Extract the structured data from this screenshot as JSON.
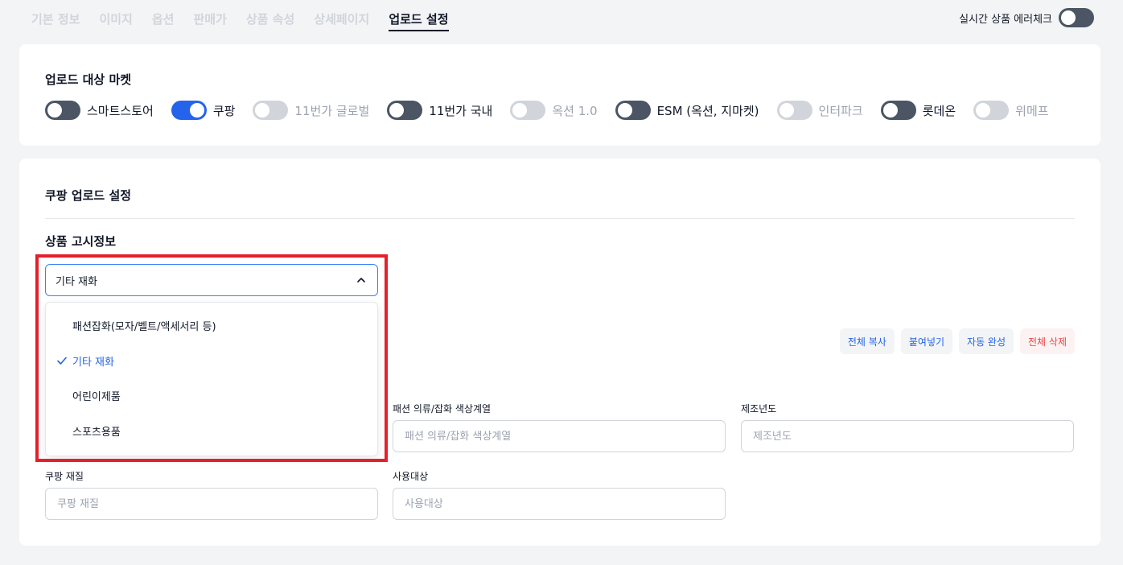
{
  "tabs": [
    {
      "label": "기본 정보"
    },
    {
      "label": "이미지"
    },
    {
      "label": "옵션"
    },
    {
      "label": "판매가"
    },
    {
      "label": "상품 속성"
    },
    {
      "label": "상세페이지"
    },
    {
      "label": "업로드 설정"
    }
  ],
  "error_check": {
    "label": "실시간 상품 에러체크",
    "enabled": false
  },
  "markets_card": {
    "title": "업로드 대상 마켓",
    "markets": [
      {
        "name": "스마트스토어",
        "state": "off"
      },
      {
        "name": "쿠팡",
        "state": "on"
      },
      {
        "name": "11번가 글로벌",
        "state": "disabled"
      },
      {
        "name": "11번가 국내",
        "state": "off"
      },
      {
        "name": "옥션 1.0",
        "state": "disabled"
      },
      {
        "name": "ESM (옥션, 지마켓)",
        "state": "off"
      },
      {
        "name": "인터파크",
        "state": "disabled"
      },
      {
        "name": "롯데온",
        "state": "off"
      },
      {
        "name": "위메프",
        "state": "disabled"
      }
    ]
  },
  "settings_card": {
    "title": "쿠팡 업로드 설정",
    "notice_section_title": "상품 고시정보",
    "select": {
      "value": "기타 재화",
      "options": [
        {
          "label": "패션잡화(모자/벨트/액세서리 등)",
          "selected": false
        },
        {
          "label": "기타 재화",
          "selected": true
        },
        {
          "label": "어린이제품",
          "selected": false
        },
        {
          "label": "스포츠용품",
          "selected": false
        }
      ]
    },
    "buttons": {
      "copy_all": "전체 복사",
      "paste": "붙여넣기",
      "autocomplete": "자동 완성",
      "delete_all": "전체 삭제"
    },
    "fields": {
      "color": {
        "label": "패션 의류/잡화 색상계열",
        "placeholder": "패션 의류/잡화 색상계열",
        "value": ""
      },
      "year": {
        "label": "제조년도",
        "placeholder": "제조년도",
        "value": ""
      },
      "material": {
        "label": "쿠팡 재질",
        "placeholder": "쿠팡 재질",
        "value": ""
      },
      "target": {
        "label": "사용대상",
        "placeholder": "사용대상",
        "value": ""
      }
    }
  },
  "colors": {
    "accent": "#2563eb",
    "highlight": "#e3202b",
    "danger": "#ef4444"
  }
}
